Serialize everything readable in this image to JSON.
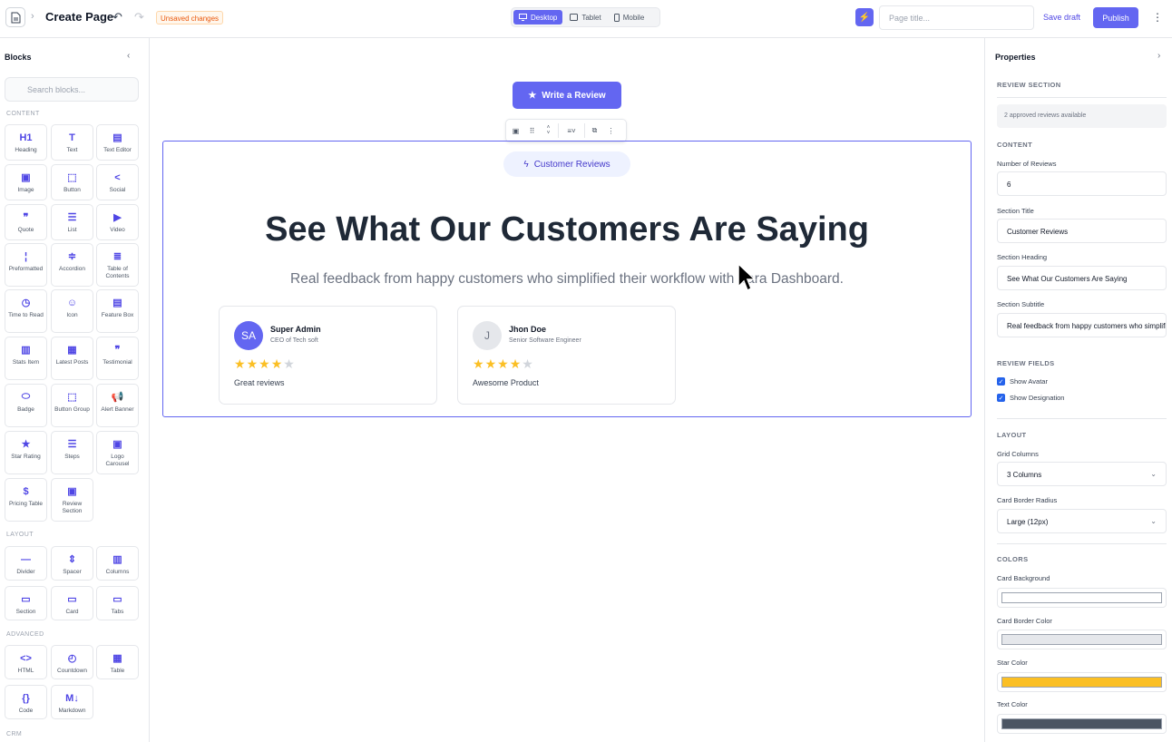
{
  "topbar": {
    "title": "Create Page",
    "unsaved": "Unsaved changes",
    "devices": [
      "Desktop",
      "Tablet",
      "Mobile"
    ],
    "active_device": "Desktop",
    "page_title_placeholder": "Page title...",
    "save_draft": "Save draft",
    "publish": "Publish"
  },
  "blocks": {
    "title": "Blocks",
    "search_placeholder": "Search blocks...",
    "sections": [
      "CONTENT",
      "LAYOUT",
      "ADVANCED",
      "CRM"
    ],
    "items": [
      {
        "label": "Heading",
        "icon": "H1"
      },
      {
        "label": "Text",
        "icon": "T"
      },
      {
        "label": "Text Editor",
        "icon": "▤"
      },
      {
        "label": "Image",
        "icon": "▣"
      },
      {
        "label": "Button",
        "icon": "⬚"
      },
      {
        "label": "Social",
        "icon": "<"
      },
      {
        "label": "Quote",
        "icon": "❞"
      },
      {
        "label": "List",
        "icon": "☰"
      },
      {
        "label": "Video",
        "icon": "▶"
      },
      {
        "label": "Preformatted",
        "icon": "¦"
      },
      {
        "label": "Accordion",
        "icon": "≑"
      },
      {
        "label": "Table of Contents",
        "icon": "≣"
      },
      {
        "label": "Time to Read",
        "icon": "◷"
      },
      {
        "label": "Icon",
        "icon": "☺"
      },
      {
        "label": "Feature Box",
        "icon": "▤"
      },
      {
        "label": "Stats Item",
        "icon": "▥"
      },
      {
        "label": "Latest Posts",
        "icon": "▦"
      },
      {
        "label": "Testimonial",
        "icon": "❞"
      },
      {
        "label": "Badge",
        "icon": "⬭"
      },
      {
        "label": "Button Group",
        "icon": "⬚"
      },
      {
        "label": "Alert Banner",
        "icon": "📢"
      },
      {
        "label": "Star Rating",
        "icon": "★"
      },
      {
        "label": "Steps",
        "icon": "☰"
      },
      {
        "label": "Logo Carousel",
        "icon": "▣"
      },
      {
        "label": "Pricing Table",
        "icon": "$"
      },
      {
        "label": "Review Section",
        "icon": "▣"
      }
    ],
    "layout_items": [
      {
        "label": "Divider",
        "icon": "—"
      },
      {
        "label": "Spacer",
        "icon": "⇕"
      },
      {
        "label": "Columns",
        "icon": "▥"
      },
      {
        "label": "Section",
        "icon": "▭"
      },
      {
        "label": "Card",
        "icon": "▭"
      },
      {
        "label": "Tabs",
        "icon": "▭"
      }
    ],
    "advanced_items": [
      {
        "label": "HTML",
        "icon": "<>"
      },
      {
        "label": "Countdown",
        "icon": "◴"
      },
      {
        "label": "Table",
        "icon": "▦"
      },
      {
        "label": "Code",
        "icon": "{}"
      },
      {
        "label": "Markdown",
        "icon": "M↓"
      }
    ]
  },
  "canvas": {
    "write_review": "Write a Review",
    "badge": "Customer Reviews",
    "heading": "See What Our Customers Are Saying",
    "subtitle": "Real feedback from happy customers who simplified their workflow with Zara Dashboard.",
    "reviews": [
      {
        "initials": "SA",
        "name": "Super Admin",
        "role": "CEO of Tech soft",
        "rating": 4,
        "text": "Great reviews",
        "avatar_bg": "#6366f1",
        "avatar_fg": "#ffffff"
      },
      {
        "initials": "J",
        "name": "Jhon Doe",
        "role": "Senior Software Engineer",
        "rating": 4,
        "text": "Awesome Product",
        "avatar_bg": "#e5e7eb",
        "avatar_fg": "#6b7280"
      }
    ]
  },
  "properties": {
    "title": "Properties",
    "review_section": "REVIEW SECTION",
    "info": "2 approved reviews available",
    "content": "CONTENT",
    "num_reviews_label": "Number of Reviews",
    "num_reviews": "6",
    "section_title_label": "Section Title",
    "section_title": "Customer Reviews",
    "section_heading_label": "Section Heading",
    "section_heading": "See What Our Customers Are Saying",
    "section_subtitle_label": "Section Subtitle",
    "section_subtitle": "Real feedback from happy customers who simplified their workflow",
    "review_fields": "REVIEW FIELDS",
    "show_avatar": "Show Avatar",
    "show_designation": "Show Designation",
    "layout": "LAYOUT",
    "grid_columns_label": "Grid Columns",
    "grid_columns": "3 Columns",
    "radius_label": "Card Border Radius",
    "radius": "Large (12px)",
    "colors": "COLORS",
    "card_bg_label": "Card Background",
    "card_bg": "#ffffff",
    "card_border_label": "Card Border Color",
    "card_border": "#e5e7eb",
    "star_label": "Star Color",
    "star": "#fbbf24",
    "text_label": "Text Color",
    "text": "#4b5563"
  },
  "colors": {
    "accent": "#6366f1",
    "star_empty": "#d1d5db"
  }
}
